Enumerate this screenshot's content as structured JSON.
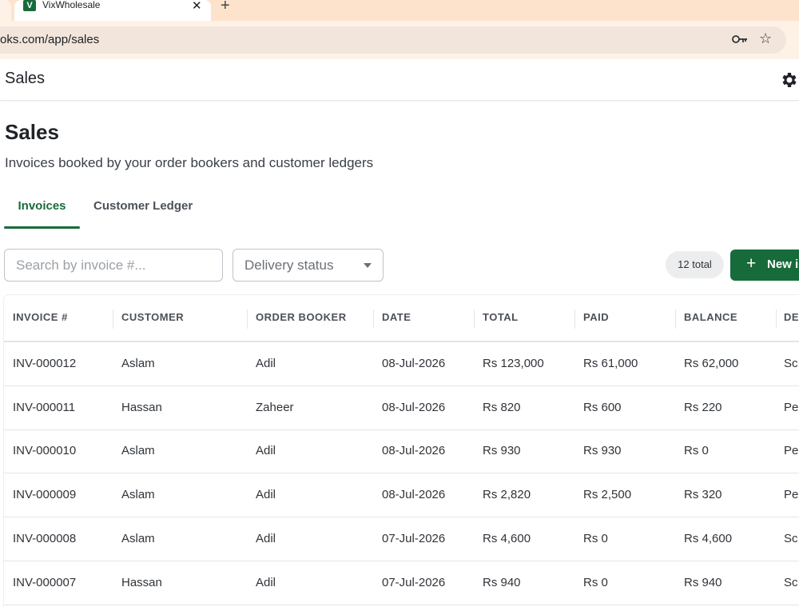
{
  "browser": {
    "tab_title": "VixWholesale",
    "tab_favicon_letter": "V",
    "url": "oks.com/app/sales"
  },
  "header": {
    "title": "Sales"
  },
  "page": {
    "title": "Sales",
    "subtitle": "Invoices booked by your order bookers and customer ledgers"
  },
  "tabs": [
    {
      "label": "Invoices",
      "active": true
    },
    {
      "label": "Customer Ledger",
      "active": false
    }
  ],
  "filters": {
    "search_placeholder": "Search by invoice #...",
    "delivery_status_label": "Delivery status"
  },
  "count_label": "12 total",
  "new_button_label": "New i",
  "table": {
    "columns": [
      "INVOICE #",
      "CUSTOMER",
      "ORDER BOOKER",
      "DATE",
      "TOTAL",
      "PAID",
      "BALANCE",
      "DE"
    ],
    "rows": [
      [
        "INV-000012",
        "Aslam",
        "Adil",
        "08-Jul-2026",
        "Rs 123,000",
        "Rs 61,000",
        "Rs 62,000",
        "Sc"
      ],
      [
        "INV-000011",
        "Hassan",
        "Zaheer",
        "08-Jul-2026",
        "Rs 820",
        "Rs 600",
        "Rs 220",
        "Pe"
      ],
      [
        "INV-000010",
        "Aslam",
        "Adil",
        "08-Jul-2026",
        "Rs 930",
        "Rs 930",
        "Rs 0",
        "Pe"
      ],
      [
        "INV-000009",
        "Aslam",
        "Adil",
        "08-Jul-2026",
        "Rs 2,820",
        "Rs 2,500",
        "Rs 320",
        "Pe"
      ],
      [
        "INV-000008",
        "Aslam",
        "Adil",
        "07-Jul-2026",
        "Rs 4,600",
        "Rs 0",
        "Rs 4,600",
        "Sc"
      ],
      [
        "INV-000007",
        "Hassan",
        "Adil",
        "07-Jul-2026",
        "Rs 940",
        "Rs 0",
        "Rs 940",
        "Sc"
      ]
    ]
  },
  "colors": {
    "brand": "#176b3a",
    "tabstrip": "#fde3cc"
  },
  "icons": [
    "key-icon",
    "star-icon",
    "gear-icon",
    "plus-icon",
    "close-icon",
    "chevron-down-icon"
  ]
}
